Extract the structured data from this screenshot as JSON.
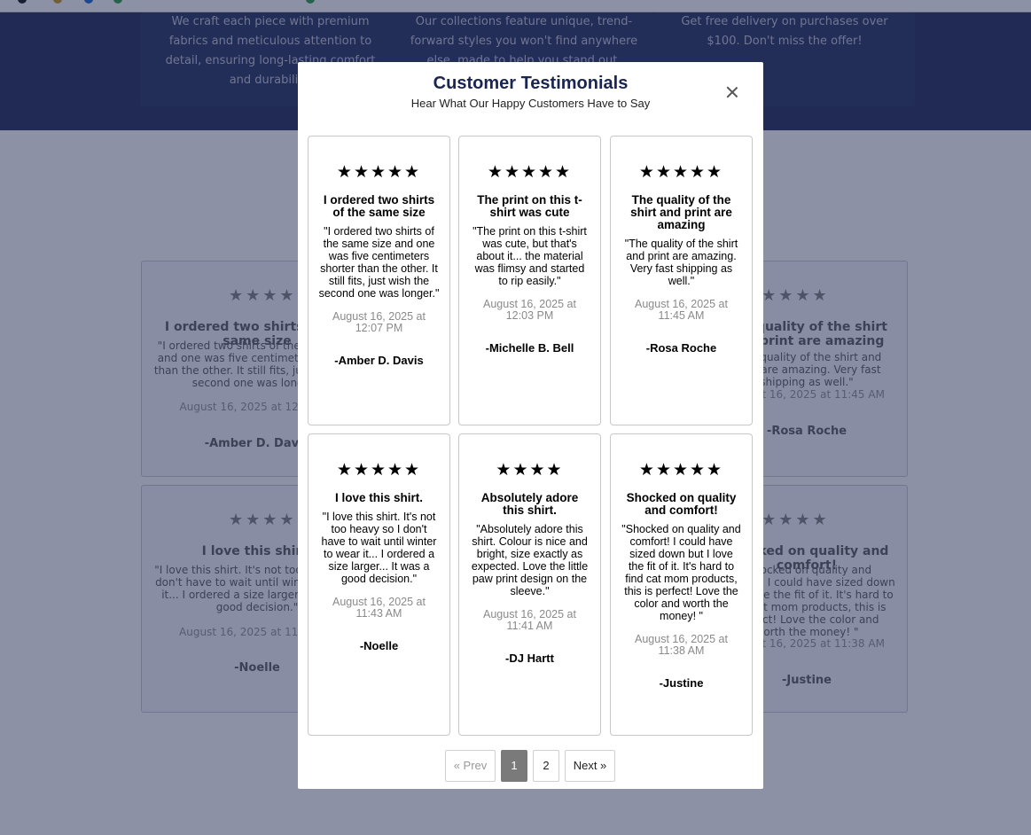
{
  "background": {
    "features": [
      {
        "text": "We craft each piece with premium fabrics and meticulous attention to detail, ensuring long-lasting comfort and durability."
      },
      {
        "text": "Our collections feature unique, trend-forward styles you won't find anywhere else, made to help you stand out."
      },
      {
        "text": "Get free delivery on purchases over $100. Don't miss the offer!"
      }
    ],
    "cards": [
      {
        "stars": "★★★★★",
        "left_title": "I ordered two shirts of the same size",
        "left_body": "\"I ordered two shirts of the same size and one was five centimeters shorter than the other. It still fits, just wish the second one was longer.\"",
        "left_date": "August 16, 2025 at 12:07 PM",
        "left_author": "-Amber D. Davis",
        "right_title": "The quality of the shirt and print are amazing",
        "right_body": "\"The quality of the shirt and print are amazing. Very fast shipping as well.\"",
        "right_date": "August 16, 2025 at 11:45 AM",
        "right_author": "-Rosa Roche"
      },
      {
        "stars": "★★★★★",
        "left_title": "I love this shirt.",
        "left_body": "\"I love this shirt. It's not too heavy so I don't have to wait until winter to wear it... I ordered a size larger... It was a good decision.\"",
        "left_date": "August 16, 2025 at 11:43 AM",
        "left_author": "-Noelle",
        "right_title": "Shocked on quality and comfort!",
        "right_body": "\"Shocked on quality and comfort! I could have sized down but I love the fit of it. It's hard to find cat mom products, this is perfect! Love the color and worth the money! \"",
        "right_date": "August 16, 2025 at 11:38 AM",
        "right_author": "-Justine"
      }
    ]
  },
  "modal": {
    "title": "Customer Testimonials",
    "subtitle": "Hear What Our Happy Customers Have to Say",
    "testimonials": [
      {
        "stars": "★★★★★",
        "title": "I ordered two shirts of the same size",
        "body": "\"I ordered two shirts of the same size and one was five centimeters shorter than the other. It still fits, just wish the second one was longer.\"",
        "date": "August 16, 2025 at 12:07 PM",
        "author": "-Amber D. Davis"
      },
      {
        "stars": "★★★★★",
        "title": "The print on this t-shirt was cute",
        "body": "\"The print on this t-shirt was cute, but that's about it... the material was flimsy and started to rip easily.\"",
        "date": "August 16, 2025 at 12:03 PM",
        "author": "-Michelle B. Bell"
      },
      {
        "stars": "★★★★★",
        "title": "The quality of the shirt and print are amazing",
        "body": "\"The quality of the shirt and print are amazing. Very fast shipping as well.\"",
        "date": "August 16, 2025 at 11:45 AM",
        "author": "-Rosa Roche"
      },
      {
        "stars": "★★★★★",
        "title": "I love this shirt.",
        "body": "\"I love this shirt. It's not too heavy so I don't have to wait until winter to wear it... I ordered a size larger... It was a good decision.\"",
        "date": "August 16, 2025 at 11:43 AM",
        "author": "-Noelle"
      },
      {
        "stars": "★★★★",
        "title": "Absolutely adore this shirt.",
        "body": "\"Absolutely adore this shirt. Colour is nice and bright, size exactly as expected. Love the little paw print design on the sleeve.\"",
        "date": "August 16, 2025 at 11:41 AM",
        "author": "-DJ Hartt"
      },
      {
        "stars": "★★★★★",
        "title": "Shocked on quality and comfort!",
        "body": "\"Shocked on quality and comfort! I could have sized down but I love the fit of it. It's hard to find cat mom products, this is perfect! Love the color and worth the money! \"",
        "date": "August 16, 2025 at 11:38 AM",
        "author": "-Justine"
      }
    ],
    "pagination": {
      "prev": "« Prev",
      "pages": [
        "1",
        "2"
      ],
      "current": "1",
      "next": "Next »"
    }
  }
}
